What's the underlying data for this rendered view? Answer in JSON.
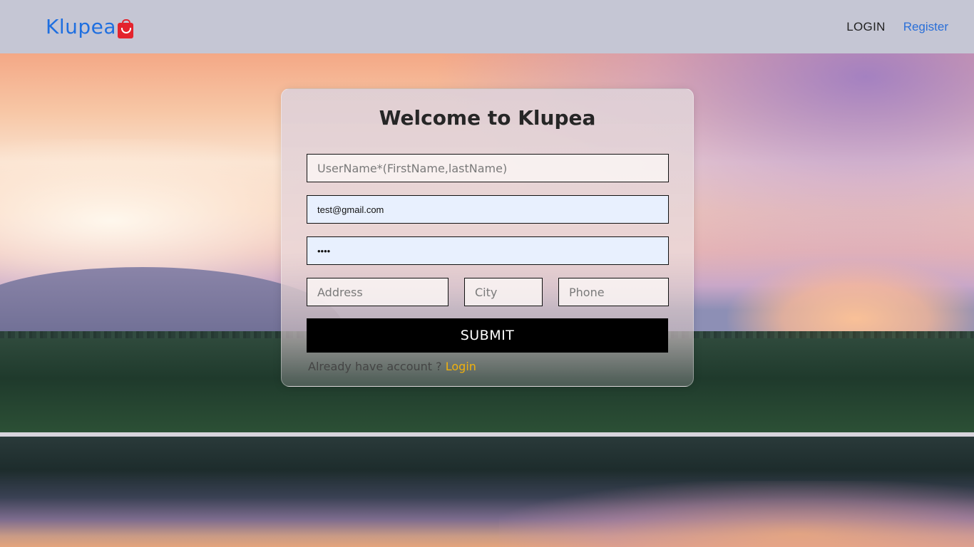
{
  "header": {
    "logo_text": "Klupea",
    "nav": {
      "login_label": "LOGIN",
      "register_label": "Register"
    }
  },
  "form": {
    "title": "Welcome to Klupea",
    "username": {
      "placeholder": "UserName*(FirstName,lastName)",
      "value": ""
    },
    "email": {
      "value": "test@gmail.com"
    },
    "password": {
      "value": "test"
    },
    "address": {
      "placeholder": "Address"
    },
    "city": {
      "placeholder": "City"
    },
    "phone": {
      "placeholder": "Phone"
    },
    "submit_label": "SUBMIT",
    "account_prompt": "Already have account ?",
    "login_link": "Login"
  },
  "colors": {
    "brand": "#1f6fe0",
    "accent_link": "#f1b10d",
    "register_link": "#2a6fd8",
    "header_bg": "#c5c6d4"
  }
}
